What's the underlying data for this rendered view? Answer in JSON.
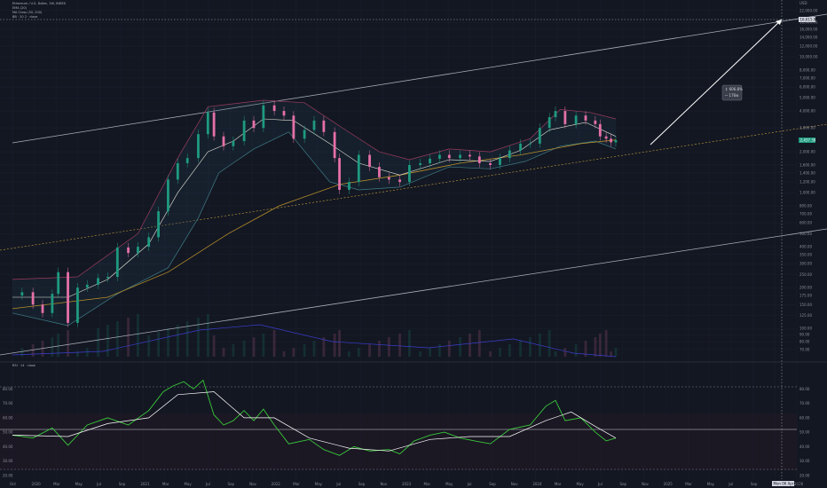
{
  "legend": {
    "title": "Ethereum / U.S. Dollar, 1W, INDEX",
    "line2": "EMA (20)",
    "line3": "MA Cross (50, 200)",
    "line4": "BB · 20 2 · close",
    "osc": "RSI · 14 · close"
  },
  "price_tag": "2,437.39",
  "target_tag": "16,615.94",
  "usd_label": "USD",
  "measure": {
    "line1": "↕ 606.8%",
    "line2": "ꟷ 176w"
  },
  "date_tag": "Mon 06 Apr '26",
  "colors": {
    "background": "#131722",
    "up": "#1e9a80",
    "down": "#e570a7",
    "ema": "#e8e8d8",
    "ma200": "#b8902a",
    "bb_upper": "#9b3b5c",
    "bb_lower": "#3f7d86",
    "rsi": "#38c93a",
    "rsi_ma": "#ffffff",
    "volume_ma": "#3b3ecf"
  },
  "chart_data": [
    {
      "type": "line",
      "title": "Ethereum / U.S. Dollar, 1W",
      "yscale": "log",
      "ylim": [
        62,
        24000
      ],
      "x_ticks": [
        "Oct",
        "2020",
        "Mar",
        "May",
        "Jul",
        "Sep",
        "2021",
        "Mar",
        "May",
        "Jul",
        "Sep",
        "Nov",
        "2022",
        "Mar",
        "May",
        "Jul",
        "Sep",
        "Nov",
        "2023",
        "Mar",
        "May",
        "Jul",
        "Sep",
        "Nov",
        "2024",
        "Mar",
        "May",
        "Jul",
        "Sep",
        "Nov",
        "2025",
        "Mar",
        "May",
        "Jul",
        "Sep",
        "Nov",
        "2026"
      ],
      "y_ticks": [
        "22,000.00",
        "18,000.00",
        "16,000.00",
        "14,000.00",
        "12,000.00",
        "10,000.00",
        "8,000.00",
        "7,000.00",
        "6,000.00",
        "5,000.00",
        "4,000.00",
        "3,000.00",
        "2,000.00",
        "1,600.00",
        "1,400.00",
        "1,200.00",
        "1,000.00",
        "800.00",
        "700.00",
        "600.00",
        "500.00",
        "400.00",
        "350.00",
        "300.00",
        "250.00",
        "200.00",
        "175.00",
        "150.00",
        "125.00",
        "100.00",
        "90.00",
        "80.00",
        "70.00"
      ],
      "series": [
        {
          "name": "Ethereum / U.S. Dollar",
          "values": [
            [
              2019.75,
              175
            ],
            [
              2019.83,
              185
            ],
            [
              2019.92,
              150
            ],
            [
              2020.0,
              130
            ],
            [
              2020.08,
              180
            ],
            [
              2020.13,
              260
            ],
            [
              2020.21,
              110
            ],
            [
              2020.29,
              200
            ],
            [
              2020.37,
              210
            ],
            [
              2020.46,
              235
            ],
            [
              2020.54,
              240
            ],
            [
              2020.62,
              395
            ],
            [
              2020.71,
              360
            ],
            [
              2020.79,
              400
            ],
            [
              2020.88,
              470
            ],
            [
              2020.96,
              730
            ],
            [
              2021.04,
              1250
            ],
            [
              2021.12,
              1650
            ],
            [
              2021.2,
              1800
            ],
            [
              2021.29,
              2700
            ],
            [
              2021.37,
              3900
            ],
            [
              2021.42,
              2600
            ],
            [
              2021.5,
              2200
            ],
            [
              2021.58,
              2400
            ],
            [
              2021.67,
              3400
            ],
            [
              2021.75,
              3000
            ],
            [
              2021.83,
              4400
            ],
            [
              2021.92,
              4000
            ],
            [
              2022.0,
              3700
            ],
            [
              2022.08,
              2500
            ],
            [
              2022.17,
              2900
            ],
            [
              2022.25,
              3400
            ],
            [
              2022.33,
              2800
            ],
            [
              2022.42,
              1800
            ],
            [
              2022.46,
              1050
            ],
            [
              2022.54,
              1200
            ],
            [
              2022.62,
              1900
            ],
            [
              2022.71,
              1550
            ],
            [
              2022.79,
              1300
            ],
            [
              2022.87,
              1250
            ],
            [
              2022.96,
              1200
            ],
            [
              2023.04,
              1600
            ],
            [
              2023.13,
              1650
            ],
            [
              2023.21,
              1780
            ],
            [
              2023.29,
              1900
            ],
            [
              2023.37,
              1800
            ],
            [
              2023.46,
              1900
            ],
            [
              2023.54,
              1850
            ],
            [
              2023.62,
              1650
            ],
            [
              2023.71,
              1600
            ],
            [
              2023.79,
              1800
            ],
            [
              2023.87,
              2050
            ],
            [
              2023.96,
              2300
            ],
            [
              2024.04,
              2300
            ],
            [
              2024.12,
              3000
            ],
            [
              2024.2,
              3600
            ],
            [
              2024.25,
              4000
            ],
            [
              2024.33,
              3200
            ],
            [
              2024.42,
              3700
            ],
            [
              2024.5,
              3400
            ],
            [
              2024.58,
              3200
            ],
            [
              2024.62,
              2600
            ],
            [
              2024.67,
              2500
            ],
            [
              2024.71,
              2350
            ],
            [
              2024.75,
              2437
            ]
          ]
        },
        {
          "name": "EMA (20)",
          "values": [
            [
              2019.75,
              170
            ],
            [
              2020.21,
              170
            ],
            [
              2020.54,
              230
            ],
            [
              2020.88,
              420
            ],
            [
              2021.12,
              1000
            ],
            [
              2021.37,
              2000
            ],
            [
              2021.58,
              2400
            ],
            [
              2021.83,
              3500
            ],
            [
              2022.08,
              3400
            ],
            [
              2022.38,
              2300
            ],
            [
              2022.62,
              1650
            ],
            [
              2022.96,
              1350
            ],
            [
              2023.37,
              1750
            ],
            [
              2023.71,
              1700
            ],
            [
              2023.96,
              2050
            ],
            [
              2024.2,
              2900
            ],
            [
              2024.5,
              3300
            ],
            [
              2024.75,
              2600
            ]
          ]
        },
        {
          "name": "MA (200)",
          "values": [
            [
              2019.75,
              140
            ],
            [
              2020.54,
              170
            ],
            [
              2021.04,
              260
            ],
            [
              2021.54,
              500
            ],
            [
              2021.96,
              800
            ],
            [
              2022.46,
              1150
            ],
            [
              2022.96,
              1350
            ],
            [
              2023.46,
              1650
            ],
            [
              2023.96,
              1900
            ],
            [
              2024.46,
              2300
            ],
            [
              2024.75,
              2450
            ]
          ]
        },
        {
          "name": "BB upper",
          "values": [
            [
              2019.75,
              230
            ],
            [
              2020.29,
              240
            ],
            [
              2020.79,
              500
            ],
            [
              2021.12,
              1800
            ],
            [
              2021.37,
              4300
            ],
            [
              2021.83,
              4800
            ],
            [
              2022.17,
              4600
            ],
            [
              2022.46,
              3100
            ],
            [
              2022.79,
              2000
            ],
            [
              2023.04,
              1750
            ],
            [
              2023.37,
              2100
            ],
            [
              2023.71,
              2000
            ],
            [
              2024.04,
              2500
            ],
            [
              2024.29,
              4100
            ],
            [
              2024.54,
              3900
            ],
            [
              2024.75,
              3500
            ]
          ]
        },
        {
          "name": "BB lower",
          "values": [
            [
              2019.75,
              130
            ],
            [
              2020.21,
              105
            ],
            [
              2020.62,
              180
            ],
            [
              2021.04,
              280
            ],
            [
              2021.29,
              650
            ],
            [
              2021.46,
              1400
            ],
            [
              2021.75,
              2100
            ],
            [
              2022.04,
              2800
            ],
            [
              2022.38,
              1200
            ],
            [
              2022.62,
              1050
            ],
            [
              2022.96,
              1100
            ],
            [
              2023.37,
              1550
            ],
            [
              2023.71,
              1500
            ],
            [
              2024.0,
              1700
            ],
            [
              2024.29,
              2200
            ],
            [
              2024.58,
              2400
            ],
            [
              2024.75,
              2100
            ]
          ]
        }
      ]
    },
    {
      "type": "line",
      "title": "RSI",
      "ylim": [
        20,
        90
      ],
      "y_ticks": [
        "80.00",
        "70.00",
        "60.00",
        "50.00",
        "40.00",
        "30.00",
        "20.00"
      ],
      "series": [
        {
          "name": "RSI",
          "values": [
            [
              2019.75,
              48
            ],
            [
              2019.92,
              46
            ],
            [
              2020.08,
              53
            ],
            [
              2020.21,
              41
            ],
            [
              2020.37,
              55
            ],
            [
              2020.54,
              60
            ],
            [
              2020.71,
              55
            ],
            [
              2020.88,
              65
            ],
            [
              2021.0,
              78
            ],
            [
              2021.08,
              82
            ],
            [
              2021.17,
              85
            ],
            [
              2021.25,
              80
            ],
            [
              2021.33,
              86
            ],
            [
              2021.42,
              62
            ],
            [
              2021.5,
              55
            ],
            [
              2021.58,
              58
            ],
            [
              2021.67,
              65
            ],
            [
              2021.75,
              58
            ],
            [
              2021.83,
              66
            ],
            [
              2021.92,
              55
            ],
            [
              2022.04,
              42
            ],
            [
              2022.21,
              45
            ],
            [
              2022.33,
              38
            ],
            [
              2022.46,
              34
            ],
            [
              2022.58,
              40
            ],
            [
              2022.71,
              37
            ],
            [
              2022.87,
              38
            ],
            [
              2022.96,
              35
            ],
            [
              2023.08,
              44
            ],
            [
              2023.21,
              48
            ],
            [
              2023.33,
              50
            ],
            [
              2023.46,
              46
            ],
            [
              2023.58,
              44
            ],
            [
              2023.71,
              42
            ],
            [
              2023.87,
              52
            ],
            [
              2024.04,
              55
            ],
            [
              2024.17,
              68
            ],
            [
              2024.25,
              72
            ],
            [
              2024.33,
              58
            ],
            [
              2024.46,
              60
            ],
            [
              2024.58,
              50
            ],
            [
              2024.67,
              44
            ],
            [
              2024.75,
              46
            ]
          ]
        },
        {
          "name": "RSI-based MA",
          "values": [
            [
              2019.75,
              48
            ],
            [
              2020.21,
              47
            ],
            [
              2020.54,
              56
            ],
            [
              2020.88,
              60
            ],
            [
              2021.12,
              76
            ],
            [
              2021.42,
              78
            ],
            [
              2021.67,
              60
            ],
            [
              2021.92,
              60
            ],
            [
              2022.21,
              46
            ],
            [
              2022.54,
              39
            ],
            [
              2022.87,
              37
            ],
            [
              2023.21,
              45
            ],
            [
              2023.54,
              47
            ],
            [
              2023.87,
              47
            ],
            [
              2024.17,
              58
            ],
            [
              2024.38,
              64
            ],
            [
              2024.58,
              54
            ],
            [
              2024.75,
              46
            ]
          ]
        }
      ]
    }
  ]
}
